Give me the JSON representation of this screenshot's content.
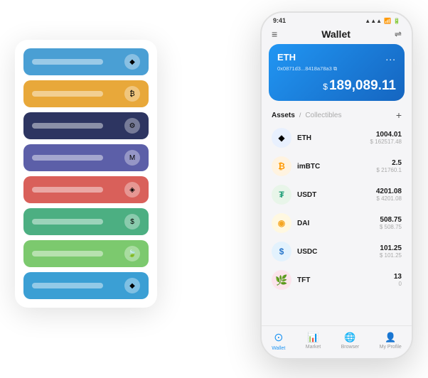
{
  "scene": {
    "phone": {
      "statusBar": {
        "time": "9:41",
        "signal": "●●●",
        "wifi": "wifi",
        "battery": "■"
      },
      "header": {
        "menuIcon": "≡",
        "title": "Wallet",
        "expandIcon": "⇌"
      },
      "ethCard": {
        "title": "ETH",
        "dots": "...",
        "address": "0x0871d3...8418a78a3 ⧉",
        "dollarSign": "$",
        "balance": "189,089.11"
      },
      "assetsSection": {
        "tabActive": "Assets",
        "divider": "/",
        "tabInactive": "Collectibles",
        "addIcon": "+"
      },
      "assets": [
        {
          "symbol": "ETH",
          "iconLabel": "◆",
          "iconClass": "asset-icon-eth",
          "amount": "1004.01",
          "usd": "$ 162517.48"
        },
        {
          "symbol": "imBTC",
          "iconLabel": "₿",
          "iconClass": "asset-icon-imbtc",
          "amount": "2.5",
          "usd": "$ 21760.1"
        },
        {
          "symbol": "USDT",
          "iconLabel": "₮",
          "iconClass": "asset-icon-usdt",
          "amount": "4201.08",
          "usd": "$ 4201.08"
        },
        {
          "symbol": "DAI",
          "iconLabel": "◈",
          "iconClass": "asset-icon-dai",
          "amount": "508.75",
          "usd": "$ 508.75"
        },
        {
          "symbol": "USDC",
          "iconLabel": "$",
          "iconClass": "asset-icon-usdc",
          "amount": "101.25",
          "usd": "$ 101.25"
        },
        {
          "symbol": "TFT",
          "iconLabel": "🍃",
          "iconClass": "asset-icon-tft",
          "amount": "13",
          "usd": "0"
        }
      ],
      "nav": [
        {
          "icon": "⊙",
          "label": "Wallet",
          "active": true
        },
        {
          "icon": "📈",
          "label": "Market",
          "active": false
        },
        {
          "icon": "🌐",
          "label": "Browser",
          "active": false
        },
        {
          "icon": "👤",
          "label": "My Profile",
          "active": false
        }
      ]
    },
    "cardStack": [
      {
        "colorClass": "card-blue",
        "label": ""
      },
      {
        "colorClass": "card-orange",
        "label": ""
      },
      {
        "colorClass": "card-dark",
        "label": ""
      },
      {
        "colorClass": "card-purple",
        "label": ""
      },
      {
        "colorClass": "card-red",
        "label": ""
      },
      {
        "colorClass": "card-green",
        "label": ""
      },
      {
        "colorClass": "card-light-green",
        "label": ""
      },
      {
        "colorClass": "card-teal",
        "label": ""
      }
    ]
  }
}
